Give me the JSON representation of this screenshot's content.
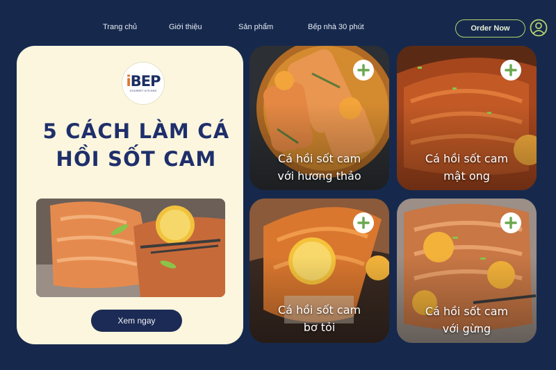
{
  "nav": {
    "links": [
      "Trang chủ",
      "Giới thiệu",
      "Sản phẩm",
      "Bếp nhà 30 phút"
    ],
    "order_label": "Order Now",
    "user_icon": "user-circle-icon"
  },
  "hero": {
    "logo": {
      "text": "iBEP",
      "tagline": "GOURMET KITCHEN"
    },
    "title_line1": "5 cách làm cá",
    "title_line2": "hồi sốt cam",
    "button_label": "Xem ngay"
  },
  "cards": [
    {
      "line1": "Cá hồi sốt cam",
      "line2": "với hương thảo"
    },
    {
      "line1": "Cá hồi sốt cam",
      "line2": "mật ong"
    },
    {
      "line1": "Cá hồi sốt cam",
      "line2": "bơ tỏi"
    },
    {
      "line1": "Cá hồi sốt cam",
      "line2": "với gừng"
    }
  ],
  "colors": {
    "background": "#16294d",
    "hero_card": "#fbf6dd",
    "title": "#1f2f6b",
    "accent_green": "#b5d36c",
    "plus_icon": "#6aa84f"
  }
}
